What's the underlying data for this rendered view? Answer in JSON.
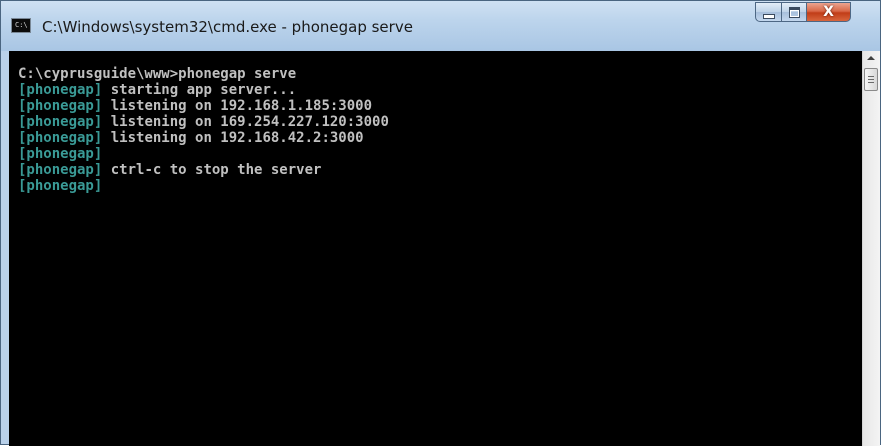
{
  "window": {
    "title": "C:\\Windows\\system32\\cmd.exe - phonegap  serve",
    "icon_label": "C:\\",
    "controls": {
      "minimize_glyph": "",
      "maximize_glyph": "",
      "close_glyph": "X"
    }
  },
  "console": {
    "lines": [
      {
        "tag": "",
        "text": "C:\\cyprusguide\\www>phonegap serve"
      },
      {
        "tag": "[phonegap]",
        "text": " starting app server..."
      },
      {
        "tag": "[phonegap]",
        "text": " listening on 192.168.1.185:3000"
      },
      {
        "tag": "[phonegap]",
        "text": " listening on 169.254.227.120:3000"
      },
      {
        "tag": "[phonegap]",
        "text": " listening on 192.168.42.2:3000"
      },
      {
        "tag": "[phonegap]",
        "text": ""
      },
      {
        "tag": "[phonegap]",
        "text": " ctrl-c to stop the server"
      },
      {
        "tag": "[phonegap]",
        "text": ""
      }
    ],
    "colors": {
      "background": "#000000",
      "text": "#c0c0c0",
      "tag": "#3a9a96"
    }
  },
  "scrollbar": {
    "up_arrow_icon": "arrow-up-icon",
    "thumb_icon": "scroll-thumb-grip-icon"
  }
}
